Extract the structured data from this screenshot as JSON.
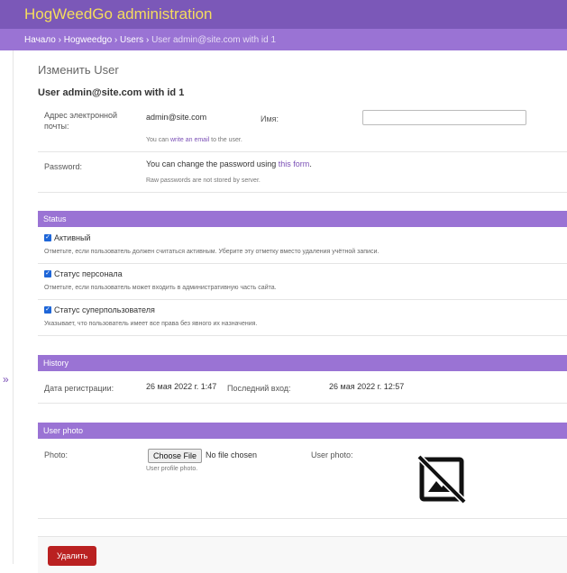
{
  "header": {
    "site_title": "HogWeedGo administration"
  },
  "breadcrumbs": {
    "home": "Начало",
    "app": "Hogweedgo",
    "model": "Users",
    "current": "User admin@site.com with id 1",
    "separator": "›"
  },
  "nav": {
    "toggle_label": "»"
  },
  "page": {
    "title": "Изменить User",
    "object_title": "User admin@site.com with id 1"
  },
  "email": {
    "label": "Адрес электронной почты:",
    "value": "admin@site.com",
    "help_prefix": "You can",
    "help_link": "write an email",
    "help_suffix": "to the user."
  },
  "name": {
    "label": "Имя:",
    "value": ""
  },
  "password": {
    "label": "Password:",
    "text_prefix": "You can change the password using",
    "link": "this form",
    "text_suffix": ".",
    "help": "Raw passwords are not stored by server."
  },
  "status": {
    "heading": "Status",
    "active": {
      "label": "Активный",
      "checked": true,
      "help": "Отметьте, если пользователь должен считаться активным. Уберите эту отметку вместо удаления учётной записи."
    },
    "staff": {
      "label": "Статус персонала",
      "checked": true,
      "help": "Отметьте, если пользователь может входить в административную часть сайта."
    },
    "superuser": {
      "label": "Статус суперпользователя",
      "checked": true,
      "help": "Указывает, что пользователь имеет все права без явного их назначения."
    }
  },
  "history": {
    "heading": "History",
    "joined_label": "Дата регистрации:",
    "joined_value": "26 мая 2022 г. 1:47",
    "last_login_label": "Последний вход:",
    "last_login_value": "26 мая 2022 г. 12:57"
  },
  "user_photo": {
    "heading": "User photo",
    "photo_label": "Photo:",
    "file_button": "Choose File",
    "no_file": "No file chosen",
    "help": "User profile photo.",
    "preview_label": "User photo:",
    "preview_icon": "broken-image-icon"
  },
  "actions": {
    "delete": "Удалить"
  },
  "colors": {
    "header": "#7b58b8",
    "breadcrumbs": "#9a73d4",
    "section": "#9a73d4",
    "site_title": "#f5dd5d",
    "delete": "#ba2121",
    "checkbox": "#1e66d8"
  }
}
